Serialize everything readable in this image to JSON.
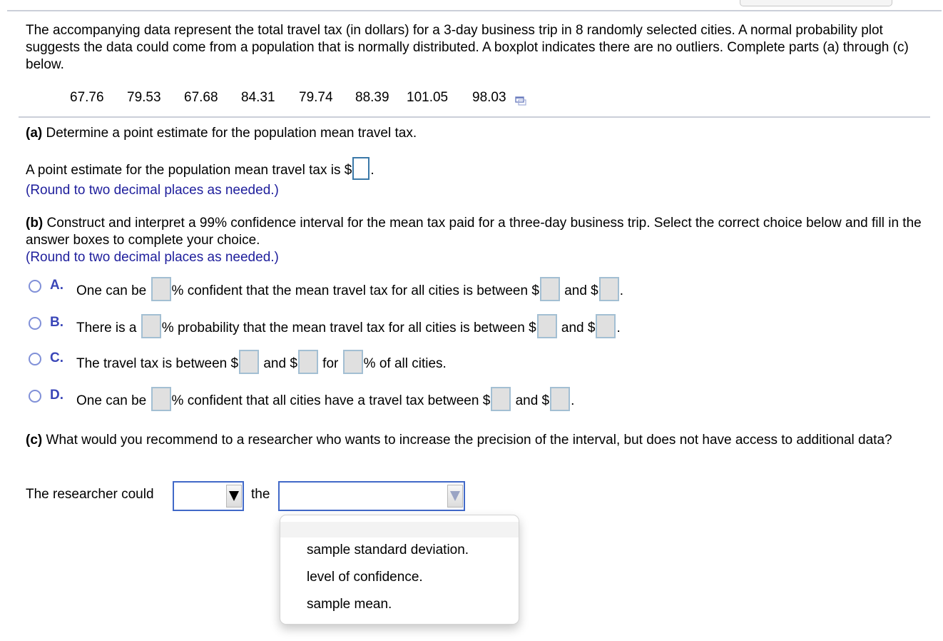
{
  "intro": {
    "text": "The accompanying data represent the total travel tax (in dollars) for a 3-day business trip in 8 randomly selected cities. A normal probability plot suggests the data could come from a population that is normally distributed. A boxplot indicates there are no outliers. Complete parts (a) through (c) below."
  },
  "data_values": [
    "67.76",
    "79.53",
    "67.68",
    "84.31",
    "79.74",
    "88.39",
    "101.05",
    "98.03"
  ],
  "part_a": {
    "label": "(a)",
    "question": " Determine a point estimate for the population mean travel tax.",
    "answer_prefix": "A point estimate for the population mean travel tax is $",
    "answer_suffix": ".",
    "answer_value": "",
    "hint": "(Round to two decimal places as needed.)"
  },
  "part_b": {
    "label": "(b)",
    "question": " Construct and interpret a 99% confidence interval for the mean tax paid for a three-day business trip. Select the correct choice below and fill in the answer boxes to complete your choice.",
    "hint": "(Round to two decimal places as needed.)",
    "options": [
      {
        "letter": "A.",
        "parts": [
          "One can be ",
          "% confident that the mean travel tax for all cities is between $",
          " and $",
          "."
        ]
      },
      {
        "letter": "B.",
        "parts": [
          "There is a ",
          "% probability that the mean travel tax for all cities is between $",
          " and $",
          "."
        ]
      },
      {
        "letter": "C.",
        "parts": [
          "The travel tax is between $",
          " and $",
          " for ",
          "% of all cities."
        ]
      },
      {
        "letter": "D.",
        "parts": [
          "One can be ",
          "% confident that all cities have a travel tax between $",
          " and $",
          "."
        ]
      }
    ]
  },
  "part_c": {
    "label": "(c)",
    "question": " What would you recommend to a researcher who wants to increase the precision of the interval, but does not have access to additional data?",
    "sentence_prefix": "The researcher could",
    "sentence_middle": "the",
    "select1_value": "",
    "select2_value": "",
    "dropdown_options": [
      "",
      "sample standard deviation.",
      "level of confidence.",
      "sample mean."
    ]
  },
  "colors": {
    "hint_text": "#1e1e9c",
    "option_letter": "#3a46b8",
    "select_border": "#4169c8",
    "divider": "#cbcfd9"
  }
}
